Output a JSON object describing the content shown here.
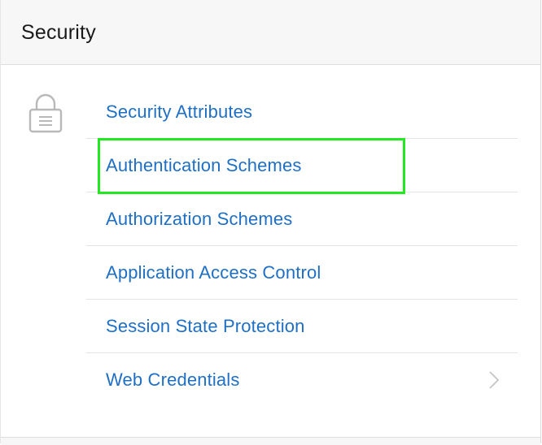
{
  "header": {
    "title": "Security"
  },
  "icon": {
    "name": "lock-icon"
  },
  "links": [
    {
      "label": "Security Attributes"
    },
    {
      "label": "Authentication Schemes"
    },
    {
      "label": "Authorization Schemes"
    },
    {
      "label": "Application Access Control"
    },
    {
      "label": "Session State Protection"
    },
    {
      "label": "Web Credentials"
    }
  ],
  "colors": {
    "link": "#1f6fc5",
    "highlight": "#22e822",
    "header_bg": "#f7f7f7",
    "divider": "#e4e4e4"
  }
}
